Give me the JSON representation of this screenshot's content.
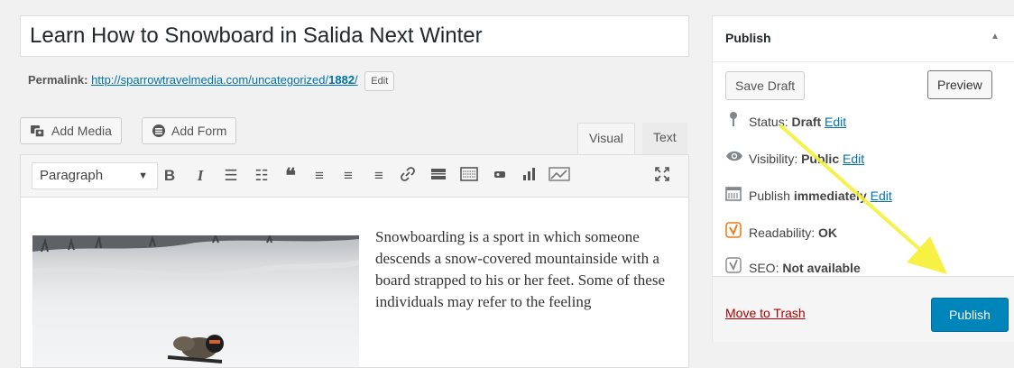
{
  "post": {
    "title": "Learn How to Snowboard in Salida Next Winter",
    "permalink_label": "Permalink:",
    "permalink_url_prefix": "http://sparrowtravelmedia.com/uncategorized/",
    "permalink_slug": "1882",
    "permalink_url_suffix": "/",
    "permalink_edit": "Edit"
  },
  "media": {
    "add_media": "Add Media",
    "add_form": "Add Form"
  },
  "editor_tabs": {
    "visual": "Visual",
    "text": "Text"
  },
  "toolbar": {
    "format": "Paragraph",
    "bold": "B",
    "italic": "I",
    "icons": [
      "bullet-list-icon",
      "numbered-list-icon",
      "blockquote-icon",
      "align-left-icon",
      "align-center-icon",
      "align-right-icon",
      "link-icon",
      "read-more-icon",
      "toolbar-toggle-icon",
      "insert-icon",
      "chart-icon",
      "image-graph-icon",
      "fullscreen-icon"
    ]
  },
  "content": {
    "paragraph": "Snowboarding is a sport in which someone descends a snow-covered mountainside with a board strapped to his or her feet. Some of these individuals may refer to the feeling"
  },
  "publish_box": {
    "title": "Publish",
    "save_draft": "Save Draft",
    "preview": "Preview",
    "status_label": "Status:",
    "status_value": "Draft",
    "visibility_label": "Visibility:",
    "visibility_value": "Public",
    "schedule_label": "Publish",
    "schedule_value": "immediately",
    "readability_label": "Readability:",
    "readability_value": "OK",
    "seo_label": "SEO:",
    "seo_value": "Not available",
    "edit_link": "Edit",
    "move_to_trash": "Move to Trash",
    "publish": "Publish"
  },
  "colors": {
    "accent": "#0085ba",
    "link": "#0073aa",
    "trash": "#a00000",
    "annotation_arrow": "#f5f03a",
    "readability_ok": "#ee7c1b"
  }
}
